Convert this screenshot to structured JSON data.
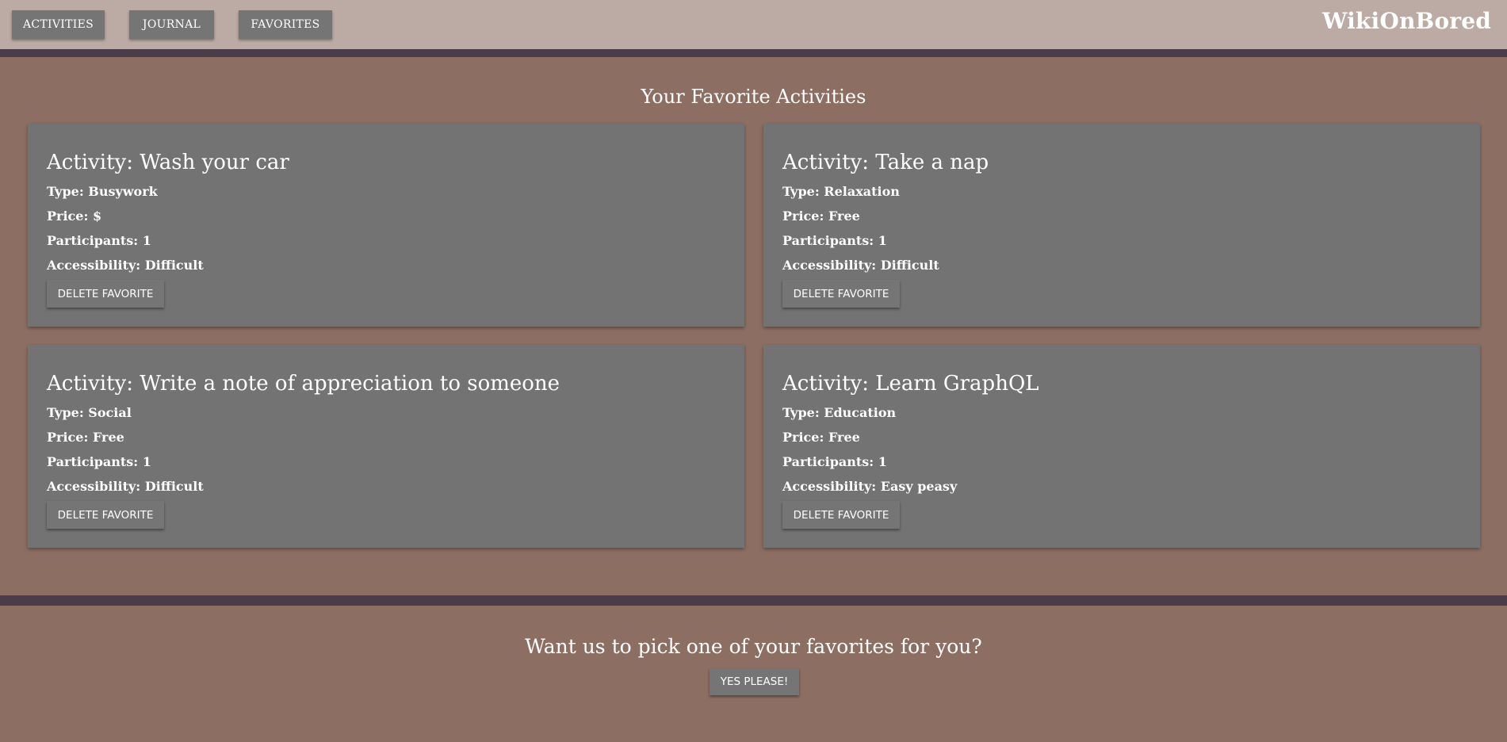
{
  "nav": {
    "buttons": [
      {
        "label": "ACTIVITIES"
      },
      {
        "label": "JOURNAL"
      },
      {
        "label": "FAVORITES"
      }
    ],
    "brand": "WikiOnBored"
  },
  "favorites": {
    "title": "Your Favorite Activities",
    "delete_label": "DELETE FAVORITE",
    "cards": [
      {
        "activity": "Activity: Wash your car",
        "type": "Type: Busywork",
        "price": "Price: $",
        "participants": "Participants: 1",
        "accessibility": "Accessibility: Difficult"
      },
      {
        "activity": "Activity: Take a nap",
        "type": "Type: Relaxation",
        "price": "Price: Free",
        "participants": "Participants: 1",
        "accessibility": "Accessibility: Difficult"
      },
      {
        "activity": "Activity: Write a note of appreciation to someone",
        "type": "Type: Social",
        "price": "Price: Free",
        "participants": "Participants: 1",
        "accessibility": "Accessibility: Difficult"
      },
      {
        "activity": "Activity: Learn GraphQL",
        "type": "Type: Education",
        "price": "Price: Free",
        "participants": "Participants: 1",
        "accessibility": "Accessibility: Easy peasy"
      }
    ]
  },
  "picker": {
    "question": "Want us to pick one of your favorites for you?",
    "button_label": "YES PLEASE!"
  },
  "colors": {
    "header_bg": "#bcaaa4",
    "page_bg": "#8c6e63",
    "card_bg": "#737373",
    "button_bg": "#757575",
    "divider": "#4a3c48"
  }
}
